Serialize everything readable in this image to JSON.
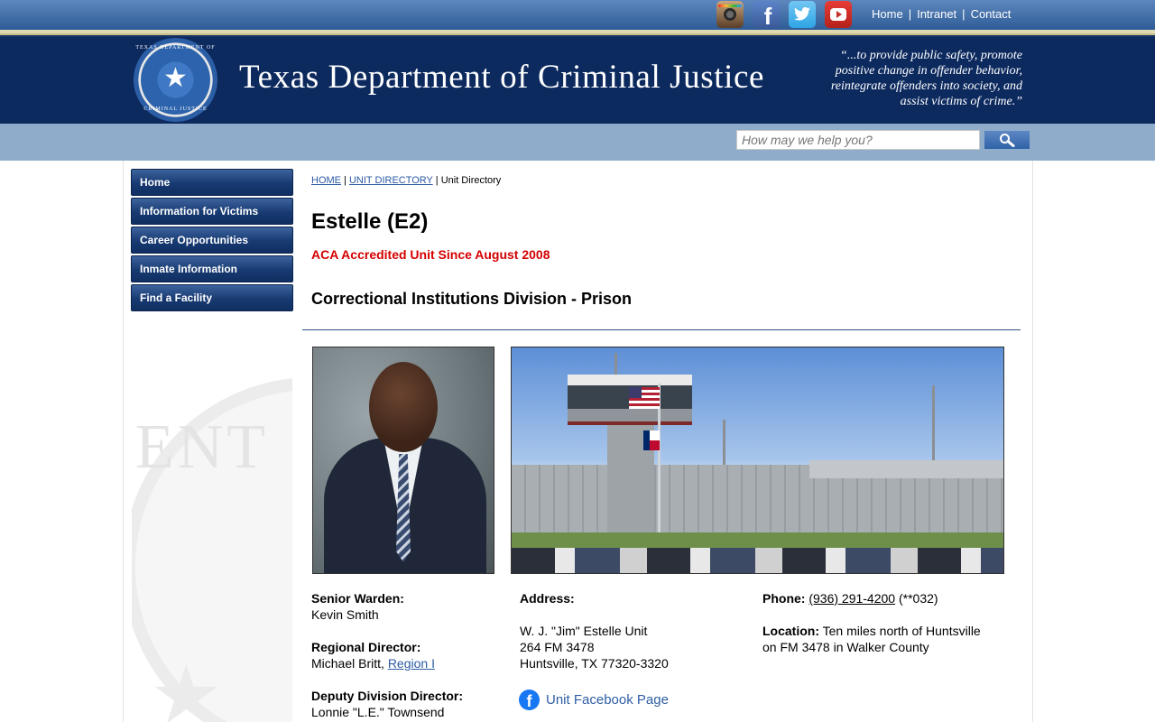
{
  "social": {
    "instagram": "instagram-icon",
    "facebook": "facebook-icon",
    "twitter": "twitter-icon",
    "youtube": "youtube-icon",
    "facebook_glyph": "f"
  },
  "top_links": {
    "home": "Home",
    "intranet": "Intranet",
    "contact": "Contact",
    "separator": "|"
  },
  "header": {
    "title": "Texas Department of Criminal Justice",
    "motto_lines": [
      "“...to provide public safety, promote",
      "positive change in offender behavior,",
      "reintegrate offenders into society, and",
      "assist victims of crime.”"
    ],
    "seal_top": "TEXAS DEPARTMENT OF",
    "seal_bottom": "CRIMINAL JUSTICE"
  },
  "search": {
    "placeholder": "How may we help you?",
    "value": ""
  },
  "nav": {
    "items": [
      {
        "label": "Home"
      },
      {
        "label": "Information for Victims"
      },
      {
        "label": "Career Opportunities"
      },
      {
        "label": "Inmate Information"
      },
      {
        "label": "Find a Facility"
      }
    ]
  },
  "breadcrumb": {
    "home": "HOME",
    "unit_directory_link": "UNIT DIRECTORY",
    "current": "Unit Directory",
    "separator": " | "
  },
  "main": {
    "title": "Estelle (E2)",
    "aca": "ACA Accredited Unit Since August 2008",
    "division": "Correctional Institutions Division - Prison"
  },
  "staff": {
    "senior_warden_label": "Senior Warden:",
    "senior_warden_name": "Kevin Smith",
    "regional_director_label": "Regional Director:",
    "regional_director_name": "Michael Britt,",
    "region_link": "Region I",
    "deputy_label": "Deputy Division Director:",
    "deputy_name": "Lonnie \"L.E.\" Townsend"
  },
  "address": {
    "label": "Address:",
    "line1": "W. J. \"Jim\" Estelle Unit",
    "line2": "264 FM 3478",
    "line3": "Huntsville, TX 77320-3320",
    "facebook_link": "Unit Facebook Page"
  },
  "contact": {
    "phone_label": "Phone:",
    "phone_number": "(936) 291-4200",
    "phone_ext": "(**032)",
    "location_label": "Location:",
    "location_line1": "Ten miles north of Huntsville",
    "location_line2": "on FM 3478 in Walker County"
  },
  "colors": {
    "header_navy": "#0d2a5f",
    "search_band": "#8fadcb",
    "aca_red": "#d40000",
    "link_blue": "#2b5aa3"
  }
}
